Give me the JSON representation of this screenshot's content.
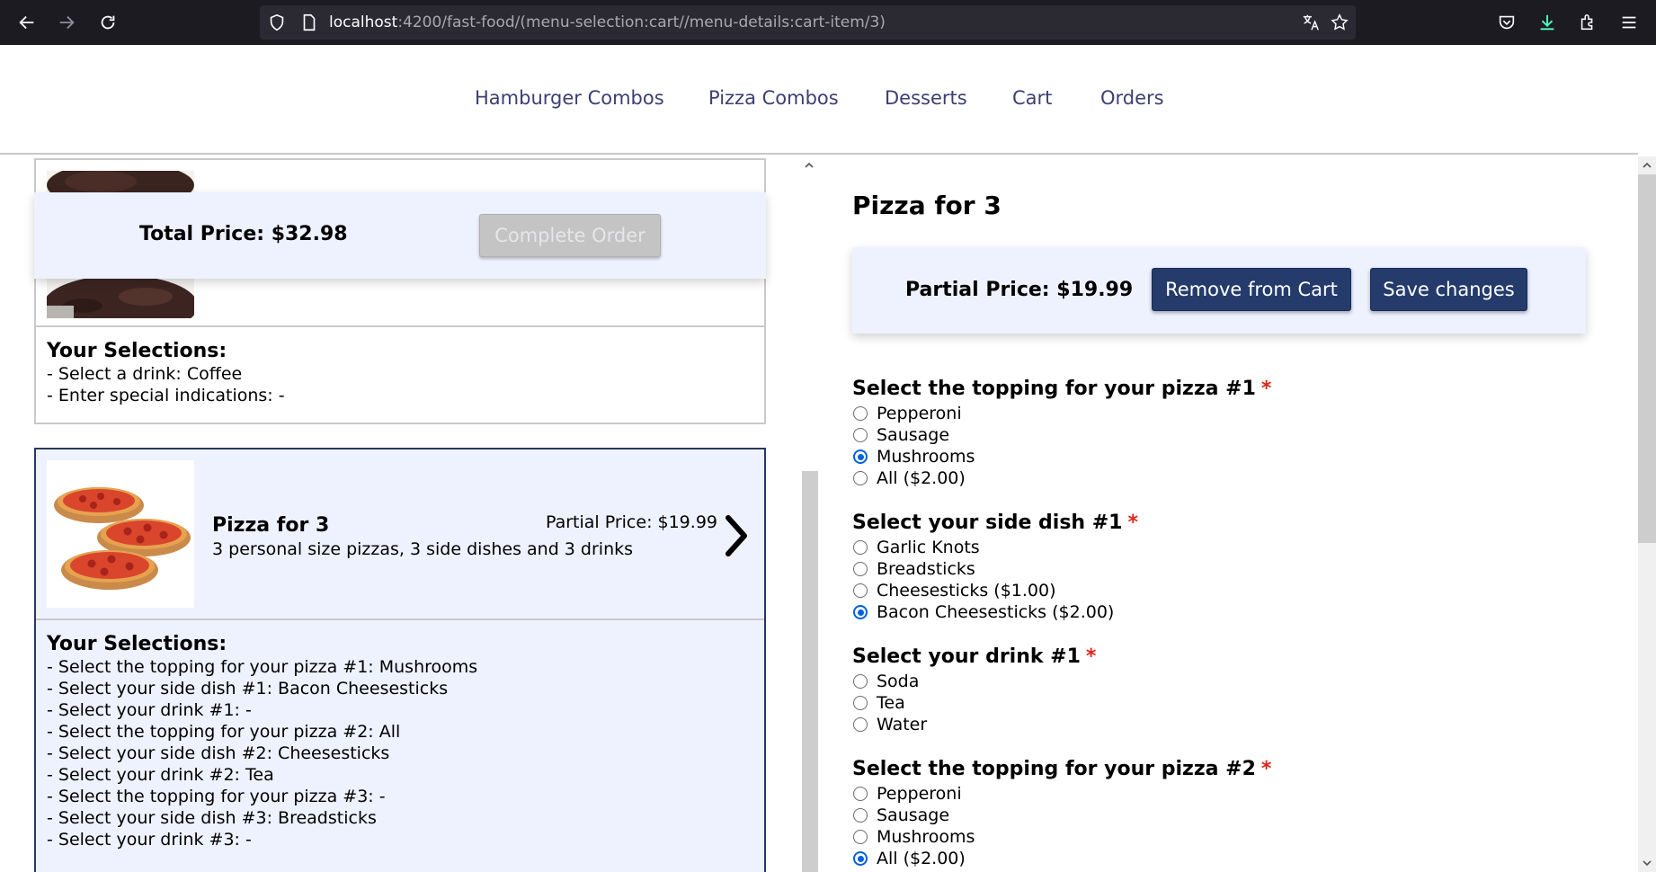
{
  "browser": {
    "url_host": "localhost",
    "url_path": ":4200/fast-food/(menu-selection:cart//menu-details:cart-item/3)"
  },
  "nav": {
    "items": [
      "Hamburger Combos",
      "Pizza Combos",
      "Desserts",
      "Cart",
      "Orders"
    ]
  },
  "cart": {
    "total_label": "Total Price: $32.98",
    "complete_label": "Complete Order",
    "items": [
      {
        "selections_title": "Your Selections:",
        "selections": [
          "- Select a drink: Coffee",
          "- Enter special indications: -"
        ]
      },
      {
        "title": "Pizza for 3",
        "description": "3 personal size pizzas, 3 side dishes and 3 drinks",
        "price": "Partial Price: $19.99",
        "selections_title": "Your Selections:",
        "selections": [
          "- Select the topping for your pizza #1: Mushrooms",
          "- Select your side dish #1: Bacon Cheesesticks",
          "- Select your drink #1: -",
          "- Select the topping for your pizza #2: All",
          "- Select your side dish #2: Cheesesticks",
          "- Select your drink #2: Tea",
          "- Select the topping for your pizza #3: -",
          "- Select your side dish #3: Breadsticks",
          "- Select your drink #3: -"
        ]
      }
    ]
  },
  "details": {
    "title": "Pizza for 3",
    "partial_price": "Partial Price: $19.99",
    "remove_label": "Remove from Cart",
    "save_label": "Save changes",
    "required_mark": "*",
    "groups": [
      {
        "title": "Select the topping for your pizza #1",
        "options": [
          "Pepperoni",
          "Sausage",
          "Mushrooms",
          "All ($2.00)"
        ],
        "selected": 2
      },
      {
        "title": "Select your side dish #1",
        "options": [
          "Garlic Knots",
          "Breadsticks",
          "Cheesesticks ($1.00)",
          "Bacon Cheesesticks ($2.00)"
        ],
        "selected": 3
      },
      {
        "title": "Select your drink #1",
        "options": [
          "Soda",
          "Tea",
          "Water"
        ],
        "selected": -1
      },
      {
        "title": "Select the topping for your pizza #2",
        "options": [
          "Pepperoni",
          "Sausage",
          "Mushrooms",
          "All ($2.00)"
        ],
        "selected": 3
      }
    ]
  },
  "colors": {
    "accent": "#243b6b",
    "nav_link": "#3b3f73",
    "panel_bg": "#eef2ff",
    "required": "#e0241a",
    "radio_checked": "#0060df"
  }
}
